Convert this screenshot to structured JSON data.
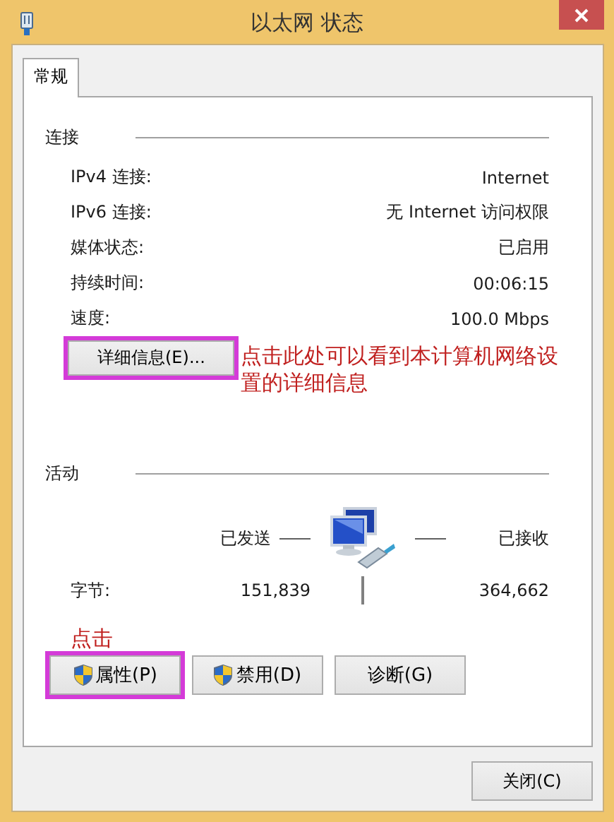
{
  "window": {
    "title": "以太网 状态"
  },
  "tabs": [
    {
      "label": "常规",
      "selected": true
    }
  ],
  "connection": {
    "heading": "连接",
    "rows": [
      {
        "label": "IPv4 连接:",
        "value": "Internet"
      },
      {
        "label": "IPv6 连接:",
        "value": "无 Internet 访问权限"
      },
      {
        "label": "媒体状态:",
        "value": "已启用"
      },
      {
        "label": "持续时间:",
        "value": "00:06:15"
      },
      {
        "label": "速度:",
        "value": "100.0 Mbps"
      }
    ]
  },
  "details_button": {
    "label": "详细信息(E)...",
    "highlighted": true,
    "note": "点击此处可以看到本计算机网络设置的详细信息"
  },
  "activity": {
    "heading": "活动",
    "sent_label": "已发送",
    "received_label": "已接收",
    "rows": [
      {
        "label": "字节:",
        "sent": "151,839",
        "received": "364,662"
      }
    ]
  },
  "buttons_note": "点击",
  "buttons": [
    {
      "label": "属性(P)",
      "shield": true,
      "highlighted": true
    },
    {
      "label": "禁用(D)",
      "shield": true,
      "highlighted": false
    },
    {
      "label": "诊断(G)",
      "shield": false,
      "highlighted": false
    }
  ],
  "close_button": {
    "label": "关闭(C)"
  }
}
